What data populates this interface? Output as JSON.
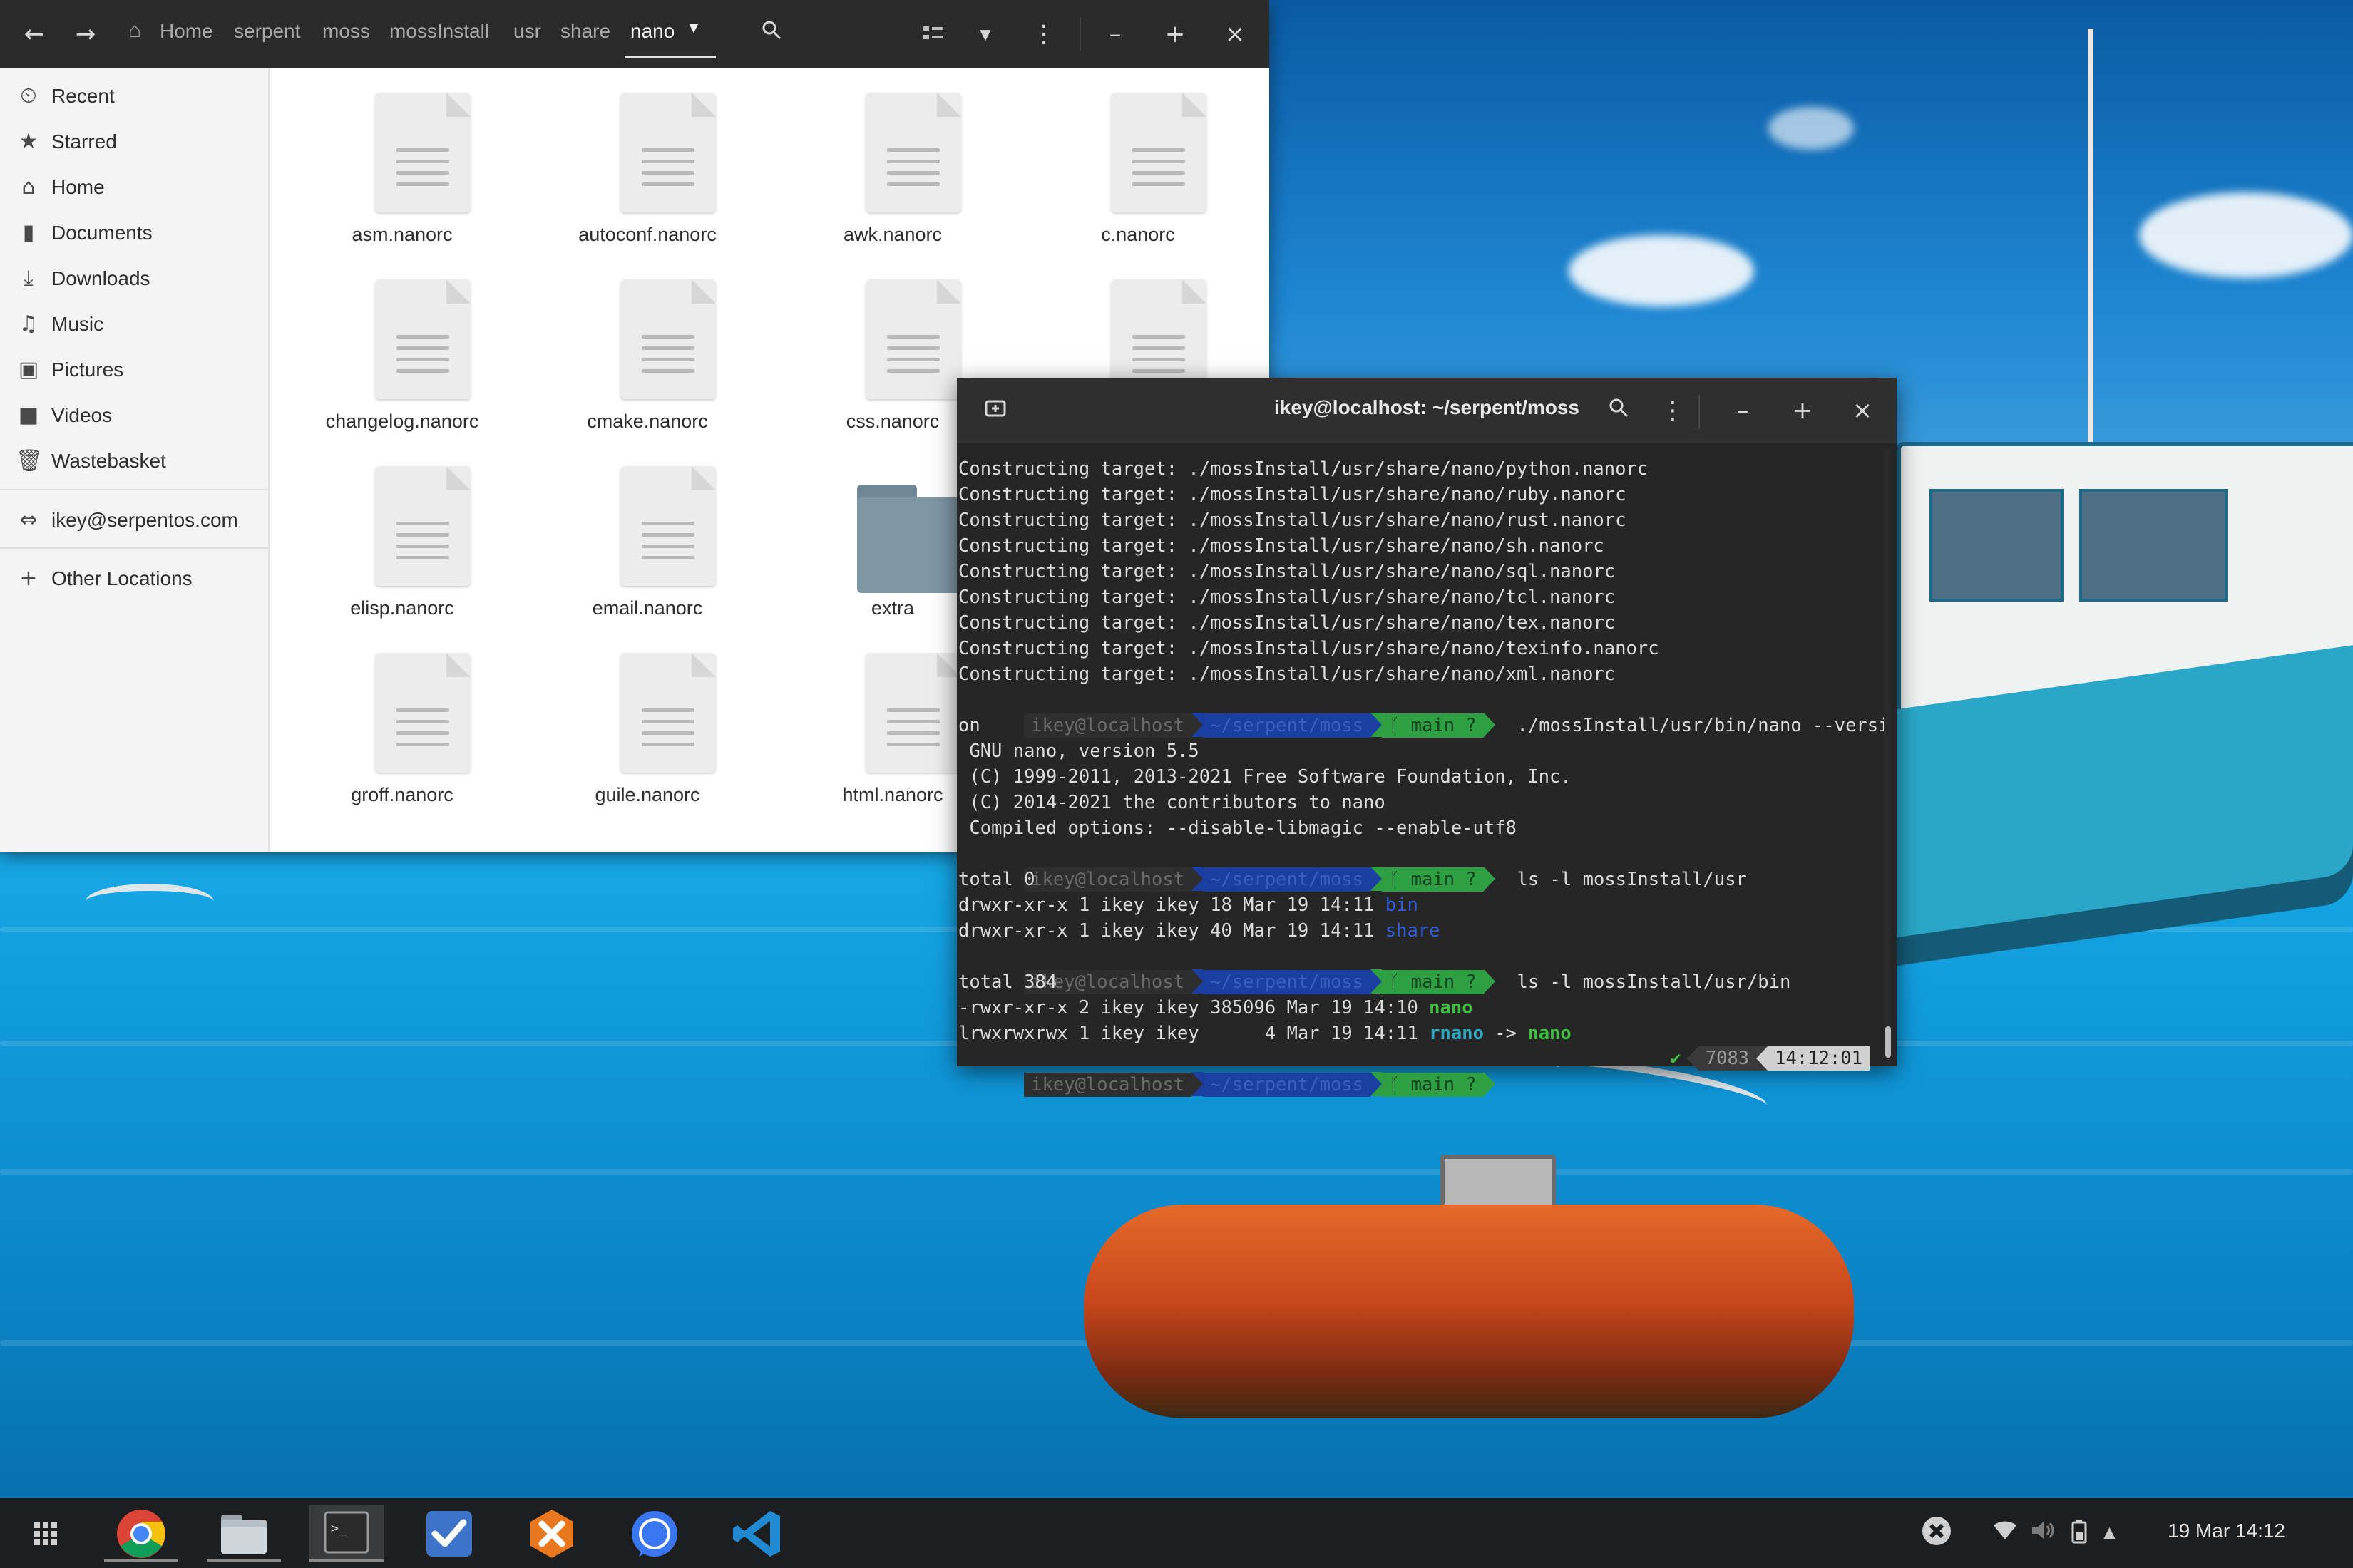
{
  "file_manager": {
    "breadcrumb": [
      "Home",
      "serpent",
      "moss",
      "mossInstall",
      "usr",
      "share",
      "nano"
    ],
    "sidebar": {
      "places": [
        {
          "label": "Recent",
          "icon": "clock-icon"
        },
        {
          "label": "Starred",
          "icon": "star-icon"
        },
        {
          "label": "Home",
          "icon": "home-icon"
        },
        {
          "label": "Documents",
          "icon": "document-icon"
        },
        {
          "label": "Downloads",
          "icon": "download-icon"
        },
        {
          "label": "Music",
          "icon": "music-icon"
        },
        {
          "label": "Pictures",
          "icon": "picture-icon"
        },
        {
          "label": "Videos",
          "icon": "video-icon"
        },
        {
          "label": "Wastebasket",
          "icon": "trash-icon"
        }
      ],
      "network": {
        "label": "ikey@serpentos.com",
        "icon": "network-icon"
      },
      "other": {
        "label": "Other Locations",
        "icon": "plus-icon"
      }
    },
    "files": [
      {
        "name": "asm.nanorc",
        "type": "document"
      },
      {
        "name": "autoconf.nanorc",
        "type": "document"
      },
      {
        "name": "awk.nanorc",
        "type": "document"
      },
      {
        "name": "c.nanorc",
        "type": "document"
      },
      {
        "name": "changelog.nanorc",
        "type": "document"
      },
      {
        "name": "cmake.nanorc",
        "type": "document"
      },
      {
        "name": "css.nanorc",
        "type": "document"
      },
      {
        "name": "",
        "type": "document"
      },
      {
        "name": "elisp.nanorc",
        "type": "document"
      },
      {
        "name": "email.nanorc",
        "type": "document"
      },
      {
        "name": "extra",
        "type": "folder"
      },
      {
        "name": "",
        "type": "document"
      },
      {
        "name": "groff.nanorc",
        "type": "document"
      },
      {
        "name": "guile.nanorc",
        "type": "document"
      },
      {
        "name": "html.nanorc",
        "type": "document"
      },
      {
        "name": "",
        "type": "document"
      }
    ]
  },
  "terminal": {
    "title": "ikey@localhost: ~/serpent/moss",
    "prompt": {
      "user": "ikey@localhost",
      "path": "~/serpent/moss",
      "branch": "main ?"
    },
    "construct_lines": [
      "Constructing target: ./mossInstall/usr/share/nano/python.nanorc",
      "Constructing target: ./mossInstall/usr/share/nano/ruby.nanorc",
      "Constructing target: ./mossInstall/usr/share/nano/rust.nanorc",
      "Constructing target: ./mossInstall/usr/share/nano/sh.nanorc",
      "Constructing target: ./mossInstall/usr/share/nano/sql.nanorc",
      "Constructing target: ./mossInstall/usr/share/nano/tcl.nanorc",
      "Constructing target: ./mossInstall/usr/share/nano/tex.nanorc",
      "Constructing target: ./mossInstall/usr/share/nano/texinfo.nanorc",
      "Constructing target: ./mossInstall/usr/share/nano/xml.nanorc"
    ],
    "cmd1": "./mossInstall/usr/bin/nano --versi",
    "cmd1_wrap": "on",
    "version_lines": [
      " GNU nano, version 5.5",
      " (C) 1999-2011, 2013-2021 Free Software Foundation, Inc.",
      " (C) 2014-2021 the contributors to nano",
      " Compiled options: --disable-libmagic --enable-utf8"
    ],
    "cmd2": "ls -l mossInstall/usr",
    "ls1_total": "total 0",
    "ls1_rows": [
      {
        "meta": "drwxr-xr-x 1 ikey ikey 18 Mar 19 14:11 ",
        "name": "bin"
      },
      {
        "meta": "drwxr-xr-x 1 ikey ikey 40 Mar 19 14:11 ",
        "name": "share"
      }
    ],
    "cmd3": "ls -l mossInstall/usr/bin",
    "ls2_total": "total 384",
    "ls2_row1": {
      "meta": "-rwxr-xr-x 2 ikey ikey 385096 Mar 19 14:10 ",
      "name": "nano"
    },
    "ls2_row2": {
      "meta": "lrwxrwxrwx 1 ikey ikey      4 Mar 19 14:11 ",
      "name": "rnano",
      "arrow": " -> ",
      "target": "nano"
    },
    "status": {
      "check": "✔",
      "count": "7083",
      "time": "14:12:01"
    }
  },
  "taskbar": {
    "apps": [
      {
        "name": "app-grid",
        "icon": "grid-icon"
      },
      {
        "name": "chrome",
        "icon": "chrome-icon"
      },
      {
        "name": "files",
        "icon": "folder-icon"
      },
      {
        "name": "terminal",
        "icon": "terminal-icon",
        "active": true
      },
      {
        "name": "tasks",
        "icon": "checkmark-icon"
      },
      {
        "name": "hexchat",
        "icon": "hexchat-icon"
      },
      {
        "name": "signal",
        "icon": "signal-icon"
      },
      {
        "name": "vscode",
        "icon": "vscode-icon"
      }
    ],
    "clock": "19 Mar  14:12"
  },
  "colors": {
    "header_bg": "#2b2b2b",
    "terminal_bg": "#262626",
    "path_blue": "#1a3fa0",
    "git_green": "#2ea043",
    "dir_blue": "#2f5ddb",
    "exec_green": "#3fbf3f"
  }
}
